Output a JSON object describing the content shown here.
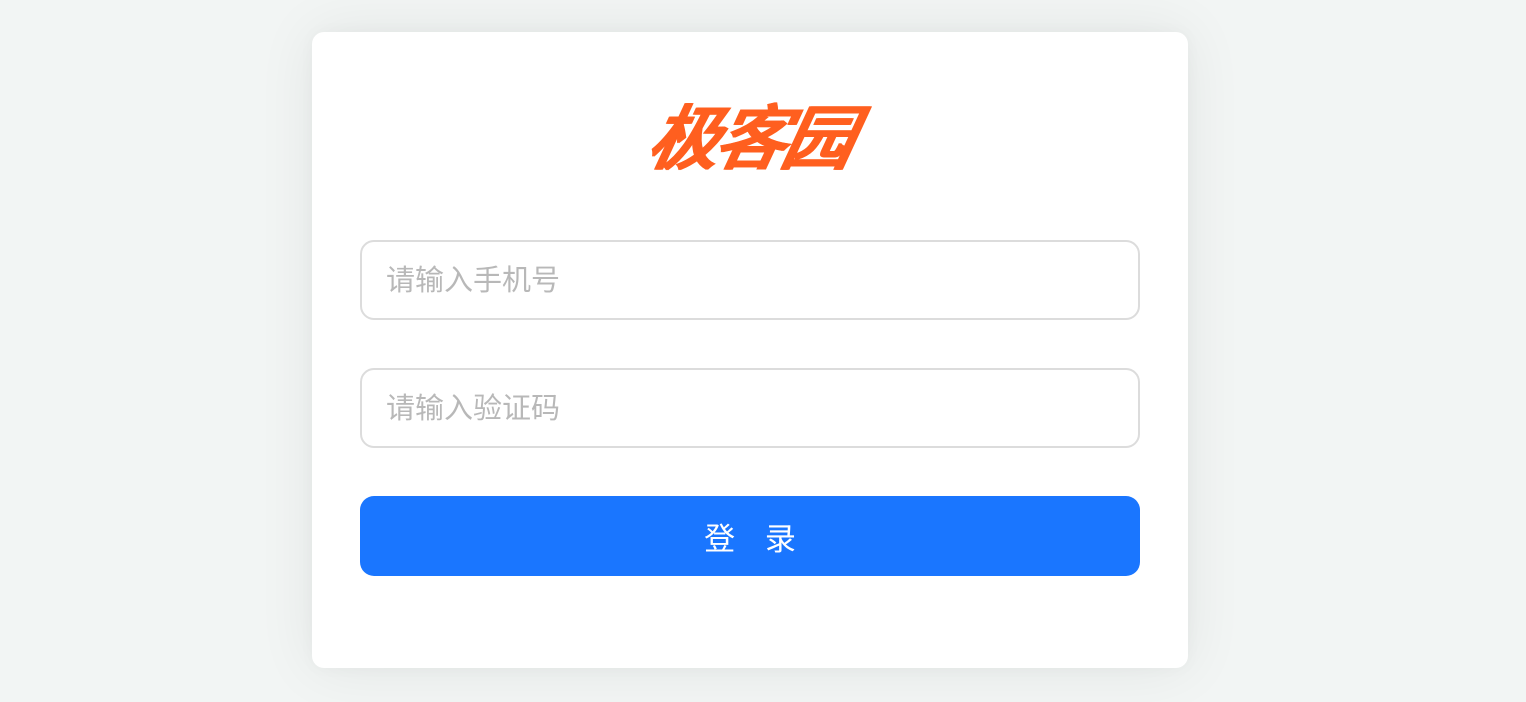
{
  "brand": {
    "logo_text": "极客园",
    "color": "#ff5f1f"
  },
  "form": {
    "phone_placeholder": "请输入手机号",
    "phone_value": "",
    "code_placeholder": "请输入验证码",
    "code_value": "",
    "submit_label": "登 录",
    "submit_color": "#1a76ff"
  }
}
